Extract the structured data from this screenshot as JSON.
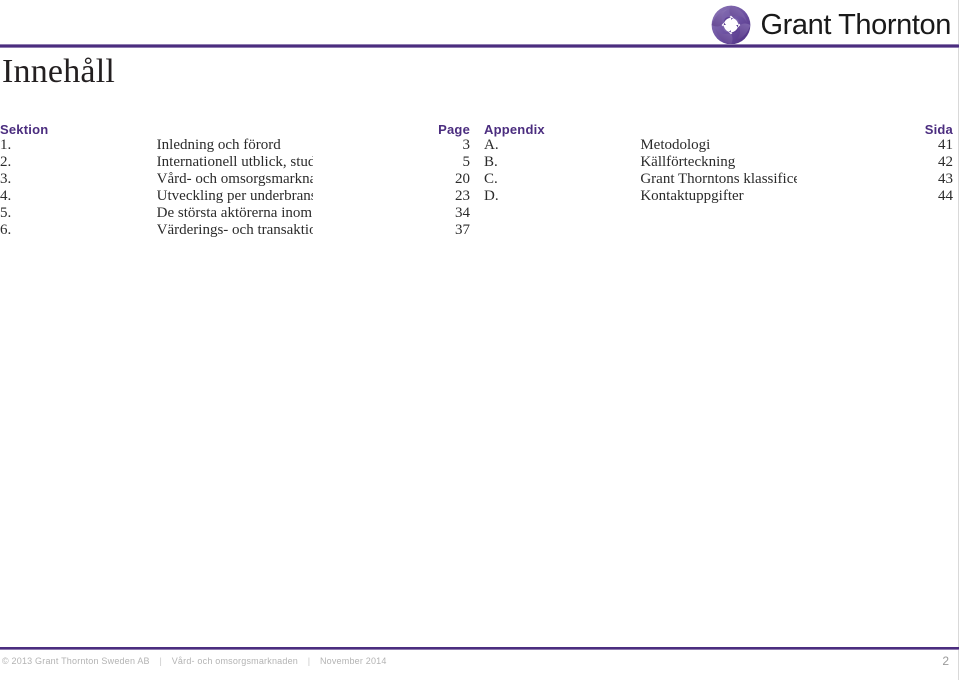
{
  "brand": {
    "name": "Grant Thornton",
    "logo_icon": "grant-thornton-swirl-icon",
    "accent_color": "#4b2d7f",
    "accent_light_color": "#8f7cb0"
  },
  "header": {
    "title": "Innehåll"
  },
  "toc": {
    "left": {
      "header_label": "Sektion",
      "header_page": "Page",
      "rows": [
        {
          "index": "1.",
          "title": "Inledning och förord",
          "page": "3"
        },
        {
          "index": "2.",
          "title": "Internationell utblick, studier och politiska risker",
          "page": "5"
        },
        {
          "index": "3.",
          "title": "Vård- och omsorgsmarknaden i Sverige",
          "page": "20"
        },
        {
          "index": "4.",
          "title": "Utveckling per underbransch",
          "page": "23"
        },
        {
          "index": "5.",
          "title": "De största aktörerna inom vård- och omsorgssektorn",
          "page": "34"
        },
        {
          "index": "6.",
          "title": "Värderings- och transaktionslandskapet",
          "page": "37"
        }
      ]
    },
    "right": {
      "header_label": "Appendix",
      "header_page": "Sida",
      "rows": [
        {
          "index": "A.",
          "title": "Metodologi",
          "page": "41"
        },
        {
          "index": "B.",
          "title": "Källförteckning",
          "page": "42"
        },
        {
          "index": "C.",
          "title": "Grant Thorntons klassificering utifrån SNI-kodsystemet",
          "page": "43"
        },
        {
          "index": "D.",
          "title": "Kontaktuppgifter",
          "page": "44"
        }
      ]
    }
  },
  "footer": {
    "copyright": "© 2013 Grant Thornton Sweden AB",
    "separator": "|",
    "document": "Vård- och omsorgsmarknaden",
    "date": "November 2014",
    "page_number": "2"
  }
}
